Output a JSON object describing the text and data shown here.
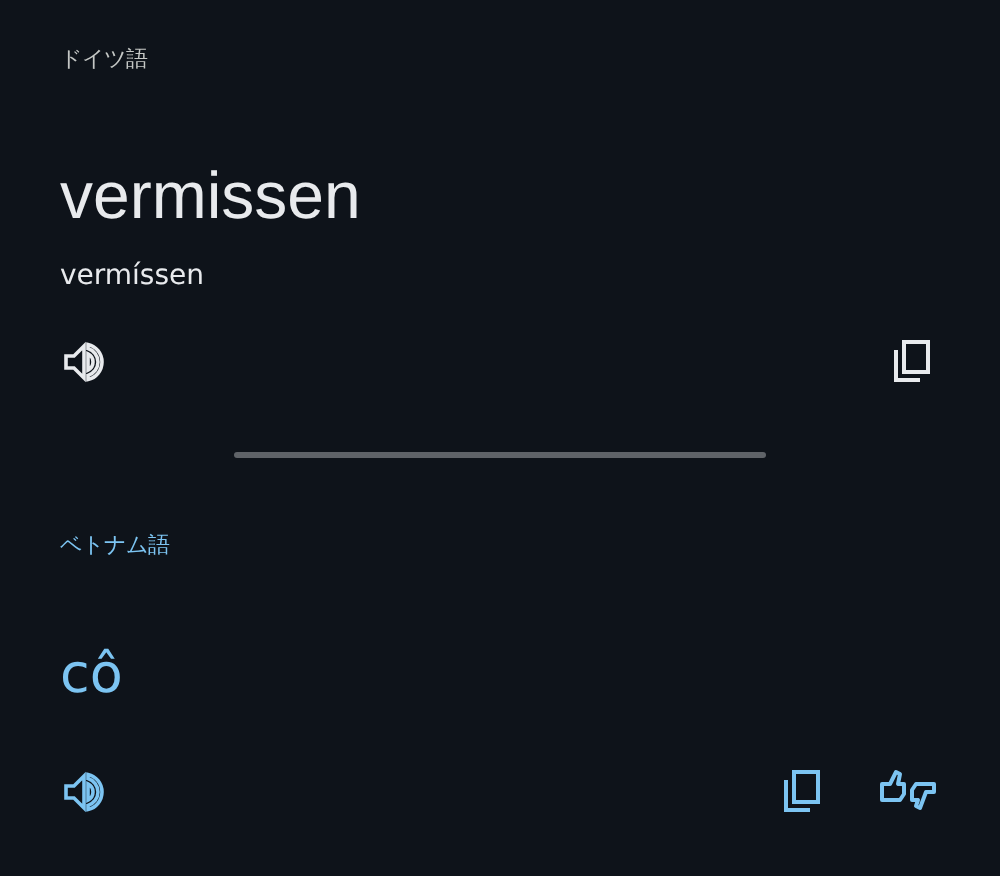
{
  "source": {
    "language": "ドイツ語",
    "text": "vermissen",
    "transliteration": "vermíssen"
  },
  "target": {
    "language": "ベトナム語",
    "text": "cô"
  }
}
